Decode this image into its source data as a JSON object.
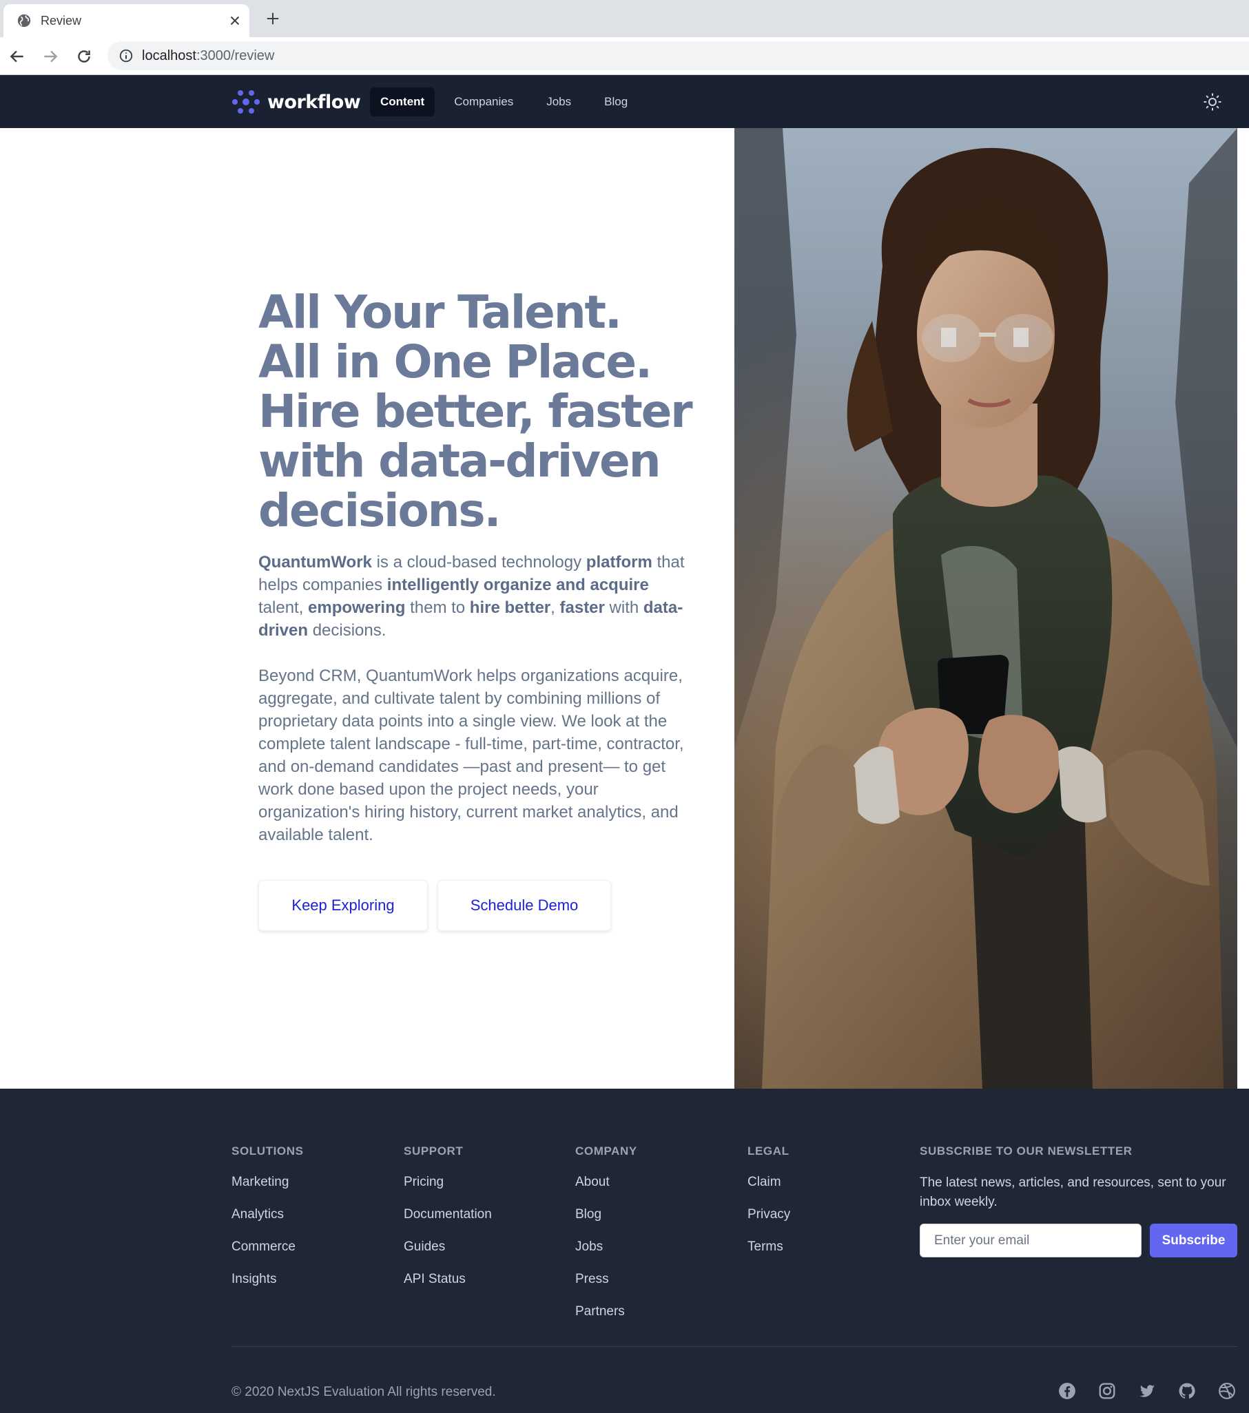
{
  "browser": {
    "tab_title": "Review",
    "url_host": "localhost",
    "url_rest": ":3000/review"
  },
  "nav": {
    "brand": "workflow",
    "links": [
      "Content",
      "Companies",
      "Jobs",
      "Blog"
    ],
    "active": "Content"
  },
  "hero": {
    "headline": [
      "All Your Talent.",
      "All in One Place.",
      "Hire better, faster",
      "with data-driven",
      "decisions."
    ],
    "para1": {
      "brand": "QuantumWork",
      "t1": " is a cloud-based technology ",
      "b1": "platform",
      "t2": " that helps companies ",
      "b2": "intelligently organize and acquire",
      "t3": " talent, ",
      "b3": "empowering",
      "t4": " them to ",
      "b4": "hire better",
      "t5": ", ",
      "b5": "faster",
      "t6": " with ",
      "b6": "data-driven",
      "t7": " decisions."
    },
    "para2": "Beyond CRM, QuantumWork helps organizations acquire, aggregate, and cultivate talent by combining millions of proprietary data points into a single view. We look at the complete talent landscape - full-time, part-time, contractor, and on-demand candidates —past and present— to get work done based upon the project needs, your organization's hiring history, current market analytics, and available talent.",
    "cta_explore": "Keep Exploring",
    "cta_demo": "Schedule Demo"
  },
  "footer": {
    "columns": [
      {
        "heading": "SOLUTIONS",
        "links": [
          "Marketing",
          "Analytics",
          "Commerce",
          "Insights"
        ]
      },
      {
        "heading": "SUPPORT",
        "links": [
          "Pricing",
          "Documentation",
          "Guides",
          "API Status"
        ]
      },
      {
        "heading": "COMPANY",
        "links": [
          "About",
          "Blog",
          "Jobs",
          "Press",
          "Partners"
        ]
      },
      {
        "heading": "LEGAL",
        "links": [
          "Claim",
          "Privacy",
          "Terms"
        ]
      }
    ],
    "newsletter": {
      "heading": "SUBSCRIBE TO OUR NEWSLETTER",
      "text": "The latest news, articles, and resources, sent to your inbox weekly.",
      "placeholder": "Enter your email",
      "button": "Subscribe"
    },
    "copyright": "© 2020 NextJS Evaluation All rights reserved.",
    "socials": [
      "facebook-icon",
      "instagram-icon",
      "twitter-icon",
      "github-icon",
      "dribbble-icon"
    ]
  },
  "colors": {
    "nav_bg": "#1a2232",
    "footer_bg": "#1f2737",
    "accent": "#6366f1",
    "headline": "#6b7a99",
    "cta_text": "#1d1fd6"
  }
}
